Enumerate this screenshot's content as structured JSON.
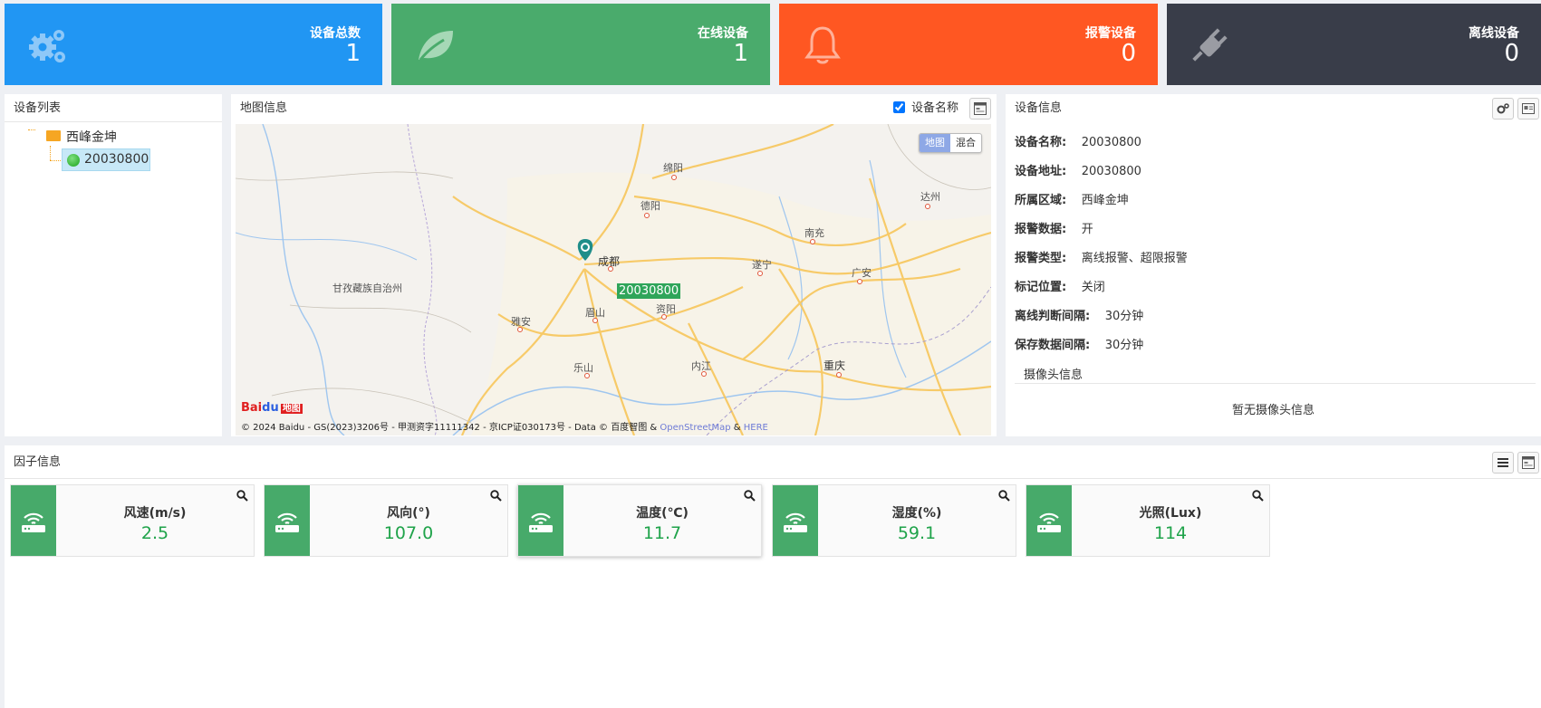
{
  "stats": [
    {
      "label": "设备总数",
      "value": "1",
      "color": "#2196f3",
      "icon": "gears-icon"
    },
    {
      "label": "在线设备",
      "value": "1",
      "color": "#4aab6c",
      "icon": "leaf-icon"
    },
    {
      "label": "报警设备",
      "value": "0",
      "color": "#ff5722",
      "icon": "bell-icon"
    },
    {
      "label": "离线设备",
      "value": "0",
      "color": "#393d49",
      "icon": "plug-icon"
    }
  ],
  "device_list": {
    "title": "设备列表",
    "root": "西峰金坤",
    "node": "20030800"
  },
  "map": {
    "title": "地图信息",
    "checkbox_label": "设备名称",
    "checkbox_checked": true,
    "toggle_map": "地图",
    "toggle_hybrid": "混合",
    "marker_label": "20030800",
    "copyright": "© 2024 Baidu - GS(2023)3206号 - 甲测资字11111342 - 京ICP证030173号 - Data © 百度智图 &",
    "osm": "OpenStreetMap",
    "amp": "&",
    "here": "HERE",
    "logo": "Bai地图",
    "cities": {
      "mianyang": "绵阳",
      "deyang": "德阳",
      "dazhou": "达州",
      "nanchong": "南充",
      "chengdu": "成都",
      "suining": "遂宁",
      "guangan": "广安",
      "ganzi": "甘孜藏族自治州",
      "meishan": "眉山",
      "ziyang": "资阳",
      "yaan": "雅安",
      "leshan": "乐山",
      "neijiang": "内江",
      "chongqing": "重庆"
    }
  },
  "device_info": {
    "title": "设备信息",
    "rows": [
      {
        "label": "设备名称:",
        "value": "20030800"
      },
      {
        "label": "设备地址:",
        "value": "20030800"
      },
      {
        "label": "所属区域:",
        "value": "西峰金坤"
      },
      {
        "label": "报警数据:",
        "value": "开"
      },
      {
        "label": "报警类型:",
        "value": "离线报警、超限报警"
      },
      {
        "label": "标记位置:",
        "value": "关闭"
      },
      {
        "label": "离线判断间隔:",
        "value": "30分钟"
      },
      {
        "label": "保存数据间隔:",
        "value": "30分钟"
      }
    ],
    "camera_title": "摄像头信息",
    "camera_empty": "暂无摄像头信息"
  },
  "factors": {
    "title": "因子信息",
    "items": [
      {
        "name": "风速(m/s)",
        "value": "2.5"
      },
      {
        "name": "风向(°)",
        "value": "107.0"
      },
      {
        "name": "温度(℃)",
        "value": "11.7"
      },
      {
        "name": "湿度(%)",
        "value": "59.1"
      },
      {
        "name": "光照(Lux)",
        "value": "114"
      }
    ]
  }
}
